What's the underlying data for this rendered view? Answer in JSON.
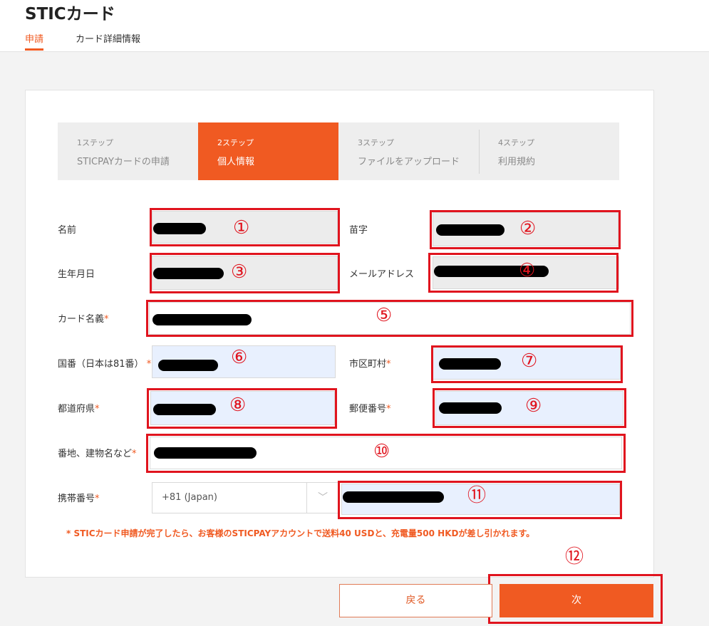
{
  "header": {
    "title": "STICカード",
    "tabs": [
      {
        "label": "申請",
        "active": true
      },
      {
        "label": "カード詳細情報",
        "active": false
      }
    ]
  },
  "steps": [
    {
      "num": "1ステップ",
      "label": "STICPAYカードの申請",
      "active": false
    },
    {
      "num": "2ステップ",
      "label": "個人情報",
      "active": true
    },
    {
      "num": "3ステップ",
      "label": "ファイルをアップロード",
      "active": false
    },
    {
      "num": "4ステップ",
      "label": "利用規約",
      "active": false
    }
  ],
  "form": {
    "first_name_label": "名前",
    "last_name_label": "苗字",
    "birth_date_label": "生年月日",
    "email_label": "メールアドレス",
    "card_name_label": "カード名義",
    "country_code_label": "国番（日本は81番）",
    "city_label": "市区町村",
    "prefecture_label": "都道府県",
    "postal_code_label": "郵便番号",
    "address_label": "番地、建物名など",
    "phone_label": "携帯番号",
    "required_mark": "*",
    "phone_country_value": "+81 (Japan)",
    "chevron": "﹀"
  },
  "markers": [
    "①",
    "②",
    "③",
    "④",
    "⑤",
    "⑥",
    "⑦",
    "⑧",
    "⑨",
    "⑩",
    "⑪",
    "⑫"
  ],
  "note": "* STICカード申請が完了したら、お客様のSTICPAYアカウントで送料40 USDと、充電量500 HKDが差し引かれます。",
  "buttons": {
    "back": "戻る",
    "next": "次"
  },
  "colors": {
    "accent": "#f05a22",
    "annotation_red": "#e0141e"
  }
}
